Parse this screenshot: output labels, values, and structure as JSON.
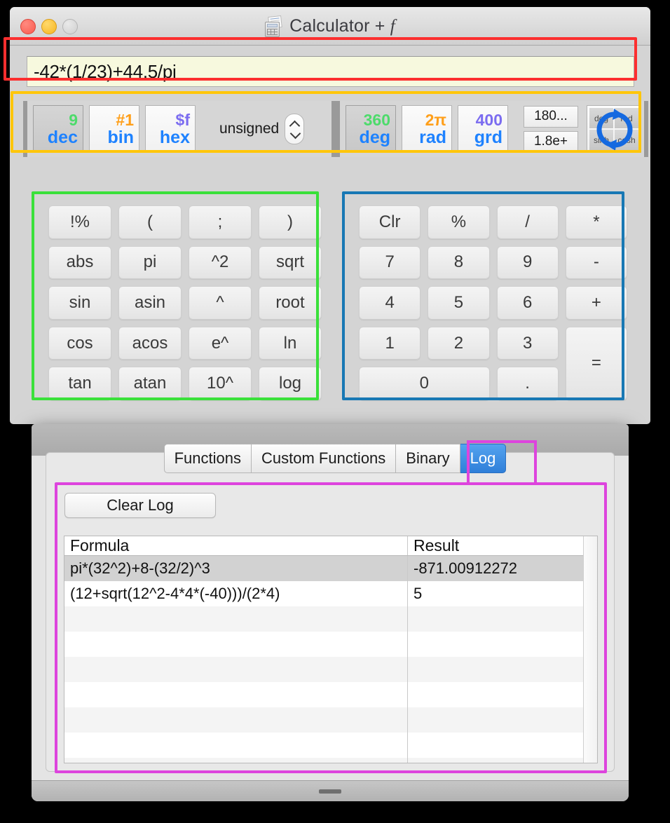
{
  "window": {
    "title": "Calculator + ",
    "title_suffix": "f",
    "icon": "calculator-document-icon",
    "traffic_lights": [
      "close",
      "minimize",
      "zoom"
    ]
  },
  "expression": {
    "value": "-42*(1/23)+44.5/pi",
    "placeholder": ""
  },
  "base_modes": [
    {
      "top": "9",
      "bottom": "dec",
      "top_color": "#4ddb6b",
      "selected": true
    },
    {
      "top": "#1",
      "bottom": "bin",
      "top_color": "#ff9f1a",
      "selected": false
    },
    {
      "top": "$f",
      "bottom": "hex",
      "top_color": "#7b6cf0",
      "selected": false
    }
  ],
  "sign_mode": {
    "label": "unsigned",
    "stepper_up": "chevron-up-icon",
    "stepper_down": "chevron-down-icon"
  },
  "angle_modes": [
    {
      "top": "360",
      "bottom": "deg",
      "top_color": "#4ddb6b",
      "selected": true
    },
    {
      "top": "2π",
      "bottom": "rad",
      "top_color": "#ff9f1a",
      "selected": false
    },
    {
      "top": "400",
      "bottom": "grd",
      "top_color": "#7b6cf0",
      "selected": false
    }
  ],
  "small_buttons": [
    {
      "label": "180..."
    },
    {
      "label": "1.8e+"
    }
  ],
  "rotate_toggle": {
    "quadrants": [
      "deg",
      "rad",
      "sinh",
      "cosh"
    ],
    "icon": "circular-rotate-arrow-icon",
    "arrow_color": "#1569e0"
  },
  "function_keys": [
    "!%",
    "(",
    ";",
    ")",
    "abs",
    "pi",
    "^2",
    "sqrt",
    "sin",
    "asin",
    "^",
    "root",
    "cos",
    "acos",
    "e^",
    "ln",
    "tan",
    "atan",
    "10^",
    "log"
  ],
  "numeric_keys": [
    {
      "label": "Clr"
    },
    {
      "label": "%"
    },
    {
      "label": "/"
    },
    {
      "label": "*"
    },
    {
      "label": "7"
    },
    {
      "label": "8"
    },
    {
      "label": "9"
    },
    {
      "label": "-"
    },
    {
      "label": "4"
    },
    {
      "label": "5"
    },
    {
      "label": "6"
    },
    {
      "label": "+"
    },
    {
      "label": "1"
    },
    {
      "label": "2"
    },
    {
      "label": "3"
    },
    {
      "label": "=",
      "span_rows": 2
    },
    {
      "label": "0",
      "span_cols": 2
    },
    {
      "label": "."
    }
  ],
  "tabs": [
    {
      "label": "Functions",
      "active": false
    },
    {
      "label": "Custom Functions",
      "active": false
    },
    {
      "label": "Binary",
      "active": false
    },
    {
      "label": "Log",
      "active": true
    }
  ],
  "log_panel": {
    "clear_button": "Clear Log",
    "columns": [
      "Formula",
      "Result"
    ],
    "rows": [
      {
        "formula": "pi*(32^2)+8-(32/2)^3",
        "result": "-871.00912272",
        "selected": true
      },
      {
        "formula": "(12+sqrt(12^2-4*4*(-40)))/(2*4)",
        "result": "5",
        "selected": false
      }
    ],
    "empty_row_count": 7
  },
  "annotations": {
    "expression_box": "#fc2f2f",
    "mode_bar_box": "#ffc60a",
    "function_pad_box": "#3ae03a",
    "numeric_pad_box": "#1878b4",
    "log_box": "#dd44dd"
  }
}
